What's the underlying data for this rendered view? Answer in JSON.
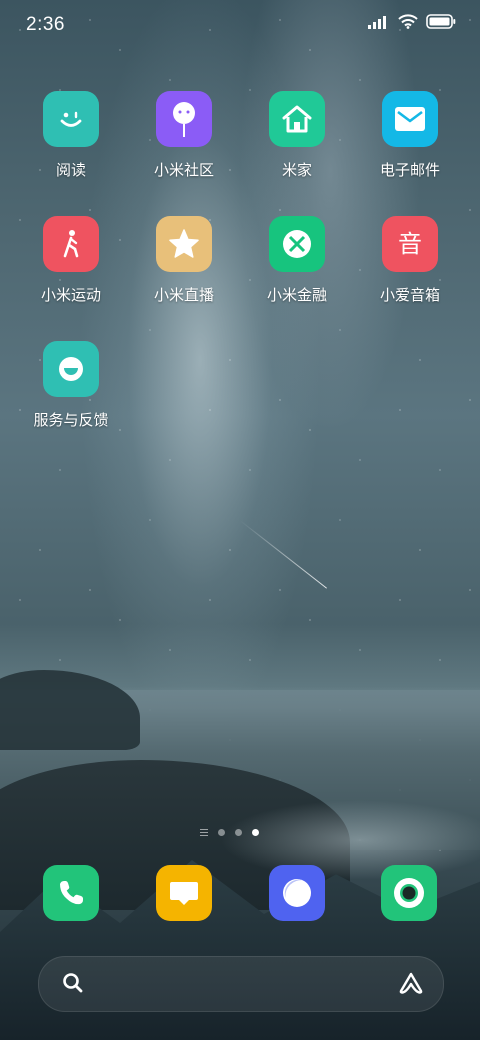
{
  "status_bar": {
    "time": "2:36",
    "icons": [
      "signal-icon",
      "wifi-icon",
      "battery-icon"
    ]
  },
  "apps": [
    {
      "label": "阅读",
      "icon": "reading-icon",
      "color": "#2fbfb3"
    },
    {
      "label": "小米社区",
      "icon": "community-icon",
      "color": "#8b5cf6"
    },
    {
      "label": "米家",
      "icon": "home-icon",
      "color": "#20c997"
    },
    {
      "label": "电子邮件",
      "icon": "mail-icon",
      "color": "#14b8e6"
    },
    {
      "label": "小米运动",
      "icon": "walking-icon",
      "color": "#ef5360"
    },
    {
      "label": "小米直播",
      "icon": "star-icon",
      "color": "#e8c07a"
    },
    {
      "label": "小米金融",
      "icon": "finance-icon",
      "color": "#17c47e"
    },
    {
      "label": "小爱音箱",
      "icon": "speaker-icon",
      "glyph": "音",
      "color": "#ef5360"
    },
    {
      "label": "服务与反馈",
      "icon": "feedback-icon",
      "color": "#2fbfb3"
    }
  ],
  "page_indicator": {
    "pages": 3,
    "active": 3
  },
  "dock": [
    {
      "icon": "phone-icon",
      "color": "#22c47a"
    },
    {
      "icon": "message-icon",
      "color": "#f5b400"
    },
    {
      "icon": "browser-icon",
      "color": "#4f63f0"
    },
    {
      "icon": "camera-icon",
      "color": "#22c47a"
    }
  ],
  "search_bar": {
    "left_icon": "search-icon",
    "right_icon": "assistant-icon"
  }
}
